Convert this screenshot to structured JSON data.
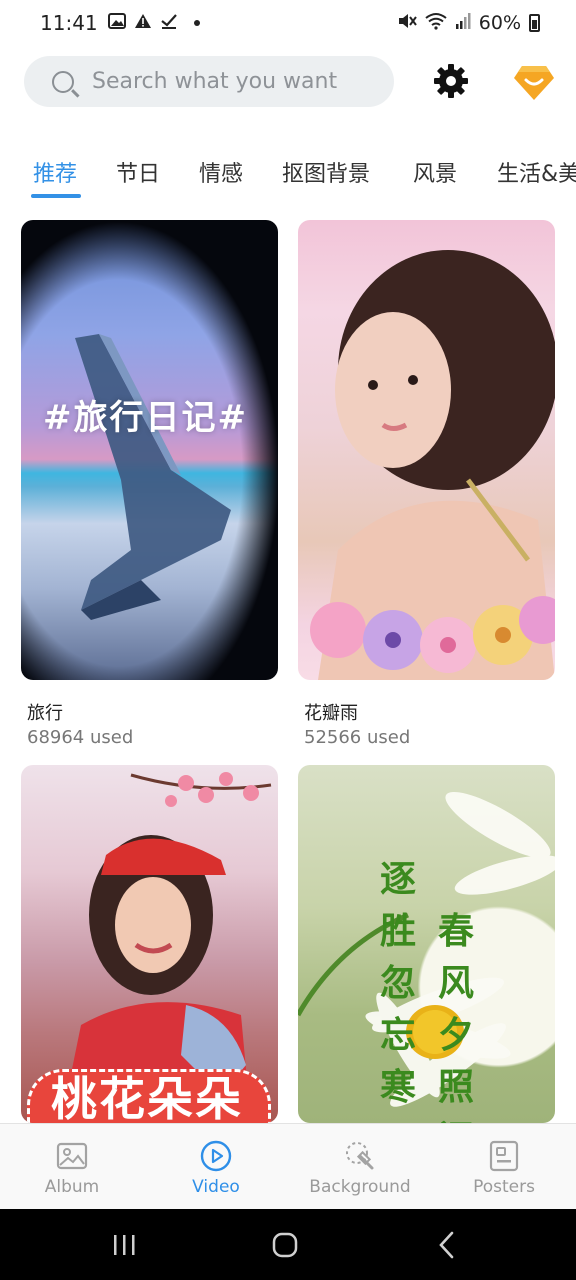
{
  "status_bar": {
    "time": "11:41",
    "battery": "60%"
  },
  "search": {
    "placeholder": "Search what you want"
  },
  "tabs": [
    {
      "label": "推荐",
      "active": true
    },
    {
      "label": "节日",
      "active": false
    },
    {
      "label": "情感",
      "active": false
    },
    {
      "label": "抠图背景",
      "active": false
    },
    {
      "label": "风景",
      "active": false
    },
    {
      "label": "生活&美",
      "active": false
    }
  ],
  "cards": [
    {
      "name": "旅行",
      "used": "68964 used",
      "overlay": "#旅行日记#"
    },
    {
      "name": "花瓣雨",
      "used": "52566 used"
    },
    {
      "overlay": "桃花朵朵"
    },
    {
      "overlay_col1": [
        "逐",
        "胜",
        "忽",
        "忘",
        "寒"
      ],
      "overlay_col2": [
        "春",
        "风",
        "夕",
        "照",
        "间"
      ]
    }
  ],
  "bottom_nav": [
    {
      "label": "Album",
      "icon": "image-icon",
      "active": false
    },
    {
      "label": "Video",
      "icon": "play-circle-icon",
      "active": true
    },
    {
      "label": "Background",
      "icon": "background-remove-icon",
      "active": false
    },
    {
      "label": "Posters",
      "icon": "poster-icon",
      "active": false
    }
  ],
  "colors": {
    "accent": "#3391e6",
    "vip": "#f5a623"
  }
}
